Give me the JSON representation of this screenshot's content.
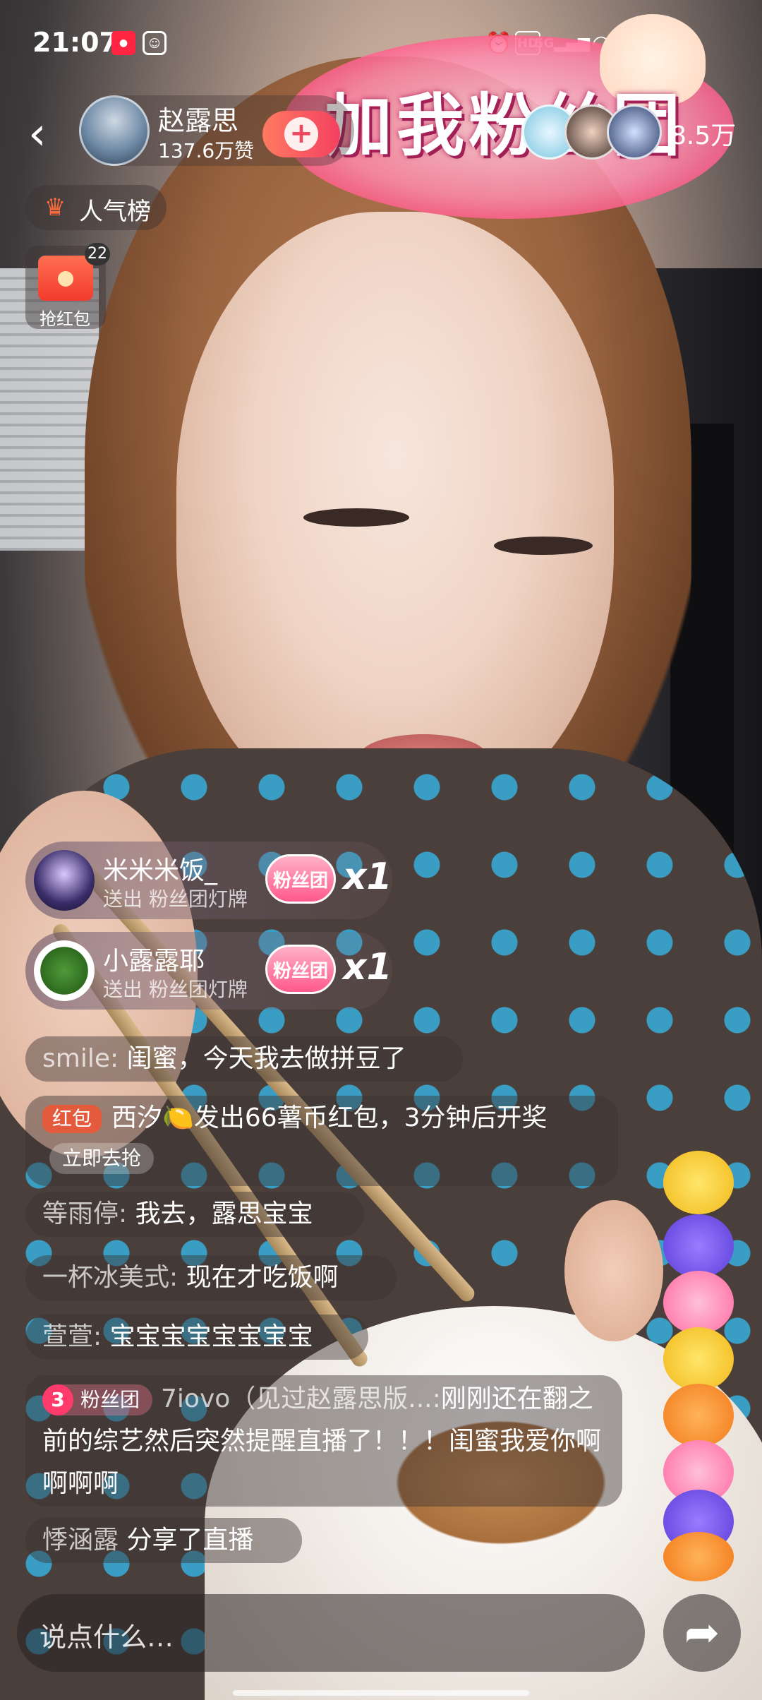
{
  "status_bar": {
    "time": "21:07",
    "icons": [
      "xiaohongshu-icon",
      "app-icon",
      "alarm-icon",
      "hd-icon",
      "signal-5g-icon",
      "wifi-icon"
    ],
    "hd": "HD",
    "net": "5G",
    "battery": "84"
  },
  "host": {
    "name": "赵露思",
    "likes": "137.6万赞",
    "follow": "+"
  },
  "banner": {
    "text": "加我粉丝团"
  },
  "viewers": {
    "count": "8.5万"
  },
  "popularity": {
    "label": "人气榜"
  },
  "red_packet": {
    "count": "22",
    "label": "抢红包"
  },
  "gifts": [
    {
      "user": "米米米饭_",
      "action": "送出 粉丝团灯牌",
      "badge": "粉丝团",
      "count": "x1"
    },
    {
      "user": "小露露耶",
      "action": "送出 粉丝团灯牌",
      "badge": "粉丝团",
      "count": "x1"
    }
  ],
  "comments": [
    {
      "name": "smile:",
      "text": "闺蜜，今天我去做拼豆了"
    },
    {
      "tag": "红包",
      "text": "西汐🍋发出66薯币红包，3分钟后开奖",
      "button": "立即去抢"
    },
    {
      "name": "等雨停:",
      "text": "我去，露思宝宝"
    },
    {
      "name": "一杯冰美式:",
      "text": "现在才吃饭啊"
    },
    {
      "name": "萱萱:",
      "text": "宝宝宝宝宝宝宝宝"
    },
    {
      "fan_level": "3",
      "fan_tag": "粉丝团",
      "name": "7iovo（见过赵露思版...:",
      "text": "刚刚还在翻之前的综艺然后突然提醒直播了！！！闺蜜我爱你啊啊啊啊"
    },
    {
      "name": "悸涵露",
      "text": "分享了直播"
    }
  ],
  "input": {
    "placeholder": "说点什么…"
  }
}
